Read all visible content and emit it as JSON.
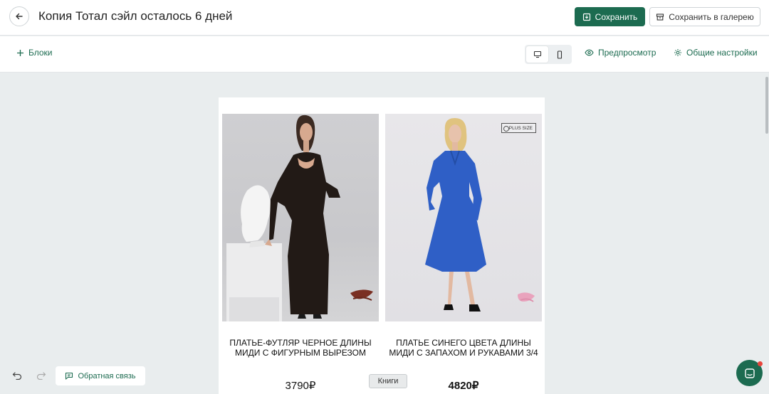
{
  "header": {
    "title": "Копия Тотал сэйл осталось 6 дней",
    "save_label": "Сохранить",
    "save_gallery_label": "Сохранить в галерею"
  },
  "toolbar": {
    "blocks_label": "Блоки",
    "preview_label": "Предпросмотр",
    "settings_label": "Общие настройки",
    "active_device": "desktop"
  },
  "products": [
    {
      "name": "ПЛАТЬЕ-ФУТЛЯР ЧЕРНОЕ ДЛИНЫ МИДИ С ФИГУРНЫМ ВЫРЕЗОМ",
      "price": "3790₽",
      "dress_color": "#221a16",
      "image_badge": ""
    },
    {
      "name": "ПЛАТЬЕ СИНЕГО ЦВЕТА ДЛИНЫ МИДИ С ЗАПАХОМ И РУКАВАМИ 3/4",
      "price": "4820₽",
      "dress_color": "#2f5fc6",
      "image_badge": "PLUS SIZE"
    }
  ],
  "tooltip": "Книги",
  "footer": {
    "feedback_label": "Обратная связь"
  },
  "colors": {
    "accent": "#1c6b50",
    "canvas_bg": "#e9edee",
    "notification": "#e8453c"
  }
}
